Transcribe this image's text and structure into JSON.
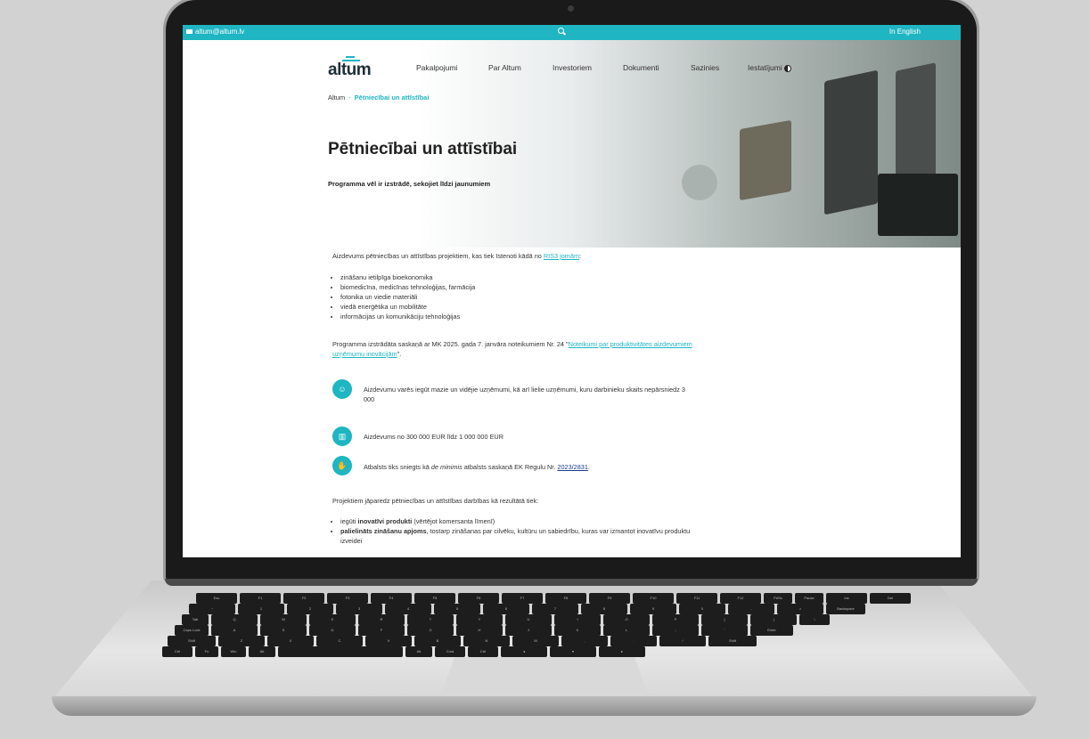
{
  "topbar": {
    "email": "altum@altum.lv",
    "language": "In English"
  },
  "logo": {
    "text": "altum"
  },
  "nav": {
    "items": [
      "Pakalpojumi",
      "Par Altum",
      "Investoriem",
      "Dokumenti",
      "Sazinies",
      "Iestatījumi"
    ]
  },
  "breadcrumb": {
    "home": "Altum",
    "separator": "-",
    "current": "Pētniecībai un attīstībai"
  },
  "hero": {
    "title": "Pētniecībai un attīstībai",
    "subtitle": "Programma vēl ir izstrādē, sekojiet līdzi jaunumiem"
  },
  "content": {
    "intro_text": "Aizdevums pētniecības un attīstības projektiem, kas tiek īstenoti kādā no ",
    "intro_link": "RIS3 jomām",
    "intro_end": ":",
    "ris3_list": [
      "zināšanu ietilpīga bioekonomika",
      "biomedicīna, medicīnas tehnoloģijas, farmācija",
      "fotonika un viedie materiāli",
      "viedā enerģētika un mobilitāte",
      "informācijas un komunikāciju tehnoloģijas"
    ],
    "regulation_text": "Programma izstrādāta saskaņā ar MK 2025. gada 7. janvāra noteikumiem Nr. 24 ",
    "regulation_quote_open": "\"",
    "regulation_link_line1": "Noteikumi par produktivitātes aizdevumiem",
    "regulation_link_line2": "uzņēmumu inovācijām",
    "regulation_end": "\".",
    "features": [
      {
        "icon": "people-coins-icon",
        "line1": "Aizdevumu varēs iegūt mazie un vidējie uzņēmumi, kā arī lielie uzņēmumi, kuru darbinieku skaits nepārsniedz 3",
        "line2": "000"
      },
      {
        "icon": "chart-growth-icon",
        "line1": "Aizdevums no 300 000 EUR līdz 1 000 000 EUR"
      },
      {
        "icon": "handshake-icon",
        "prefix": "Atbalsts tiks sniegts kā ",
        "italic": "de minimis",
        "middle": " atbalsts saskaņā  EK Regulu Nr. ",
        "link": "2023/2831",
        "suffix": "."
      }
    ],
    "results_intro": "Projektiem jāparedz pētniecības un attīstības darbības kā rezultātā tiek:",
    "results": [
      {
        "pre": "iegūti ",
        "bold": "inovatīvi produkti",
        "post": " (vērtējot komersanta līmenī)"
      },
      {
        "pre": "",
        "bold": "palielināts zināšanu apjoms",
        "post": ", tostarp zināšanas par cilvēku, kultūru un sabiedrību, kuras var izmantot inovatīvu produktu",
        "line2": "izveidei"
      }
    ]
  },
  "keyboard": {
    "row1": [
      "Esc",
      "F1",
      "F2",
      "F3",
      "F4",
      "F5",
      "F6",
      "F7",
      "F8",
      "F9",
      "F10",
      "F11",
      "F12",
      "PrtSc",
      "Pause",
      "Ins",
      "Del"
    ],
    "row2": [
      "~",
      "1",
      "2",
      "3",
      "4",
      "5",
      "6",
      "7",
      "8",
      "9",
      "0",
      "-",
      "=",
      "Backspace"
    ],
    "row3": [
      "Tab",
      "Q",
      "W",
      "E",
      "R",
      "T",
      "Y",
      "U",
      "I",
      "O",
      "P",
      "[",
      "]",
      "\\"
    ],
    "row4": [
      "Caps Lock",
      "A",
      "S",
      "D",
      "F",
      "G",
      "H",
      "J",
      "K",
      "L",
      ";",
      "'",
      "Enter"
    ],
    "row5": [
      "Shift",
      "Z",
      "X",
      "C",
      "V",
      "B",
      "N",
      "M",
      ",",
      ".",
      "/",
      "Shift"
    ],
    "row6": [
      "Ctrl",
      "Fn",
      "Win",
      "Alt",
      "",
      "Alt",
      "Cmd",
      "Ctrl",
      "◂",
      "▾",
      "▸"
    ]
  },
  "colors": {
    "accent": "#1fb5c2",
    "text": "#333333"
  }
}
